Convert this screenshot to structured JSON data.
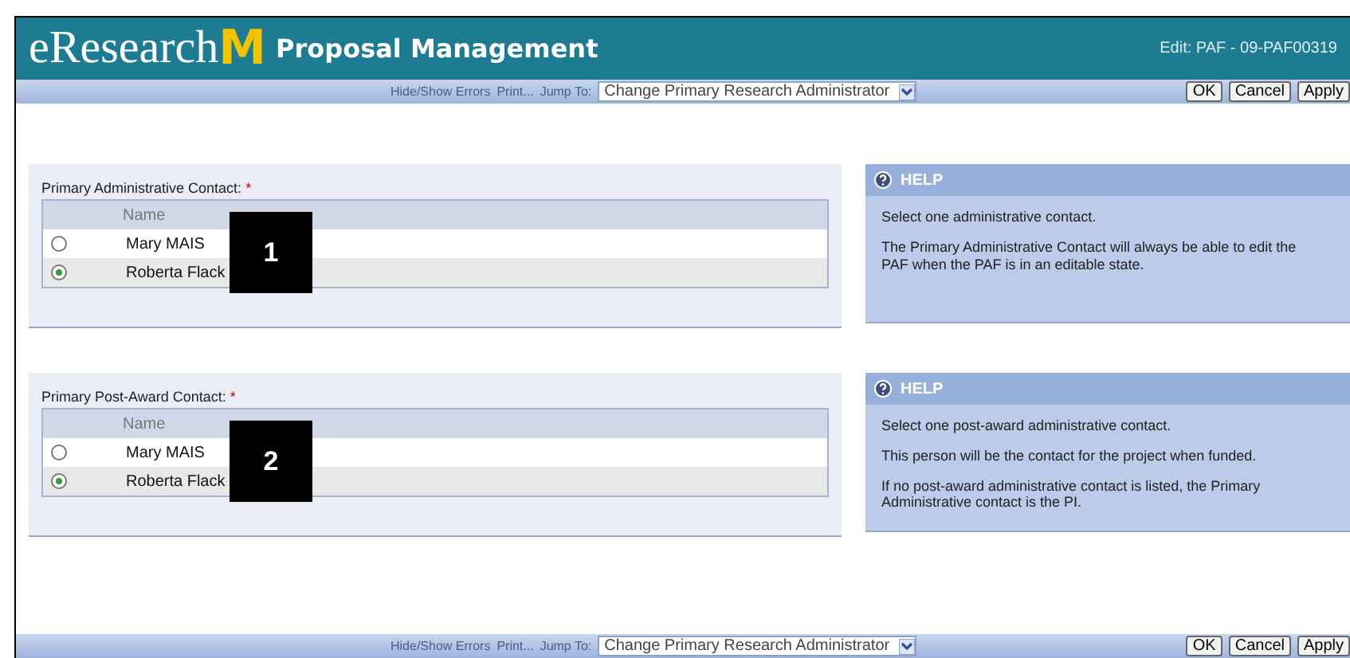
{
  "header": {
    "logo_text": "eResearch",
    "logo_letter": "M",
    "app_title": "Proposal Management",
    "context": "Edit: PAF - 09-PAF00319"
  },
  "toolbars": [
    {
      "links": [
        "Hide/Show Errors",
        "Print..."
      ],
      "jump_label": "Jump To:",
      "jump_value": "Change Primary Research Administrator",
      "buttons": [
        "OK",
        "Cancel",
        "Apply"
      ]
    },
    {
      "links": [
        "Hide/Show Errors",
        "Print..."
      ],
      "jump_label": "Jump To:",
      "jump_value": "Change Primary Research Administrator",
      "buttons": [
        "OK",
        "Cancel",
        "Apply"
      ]
    }
  ],
  "sections": [
    {
      "label": "Primary Administrative Contact:",
      "required_mark": "*",
      "column": "Name",
      "callout": "1",
      "rows": [
        {
          "name": "Mary MAIS",
          "selected": false
        },
        {
          "name": "Roberta Flack",
          "selected": true
        }
      ],
      "help_title": "HELP",
      "help": [
        "Select one administrative contact.",
        "The Primary Administrative Contact will always be able to edit the PAF when the PAF is in an editable state."
      ]
    },
    {
      "label": "Primary Post-Award Contact:",
      "required_mark": "*",
      "column": "Name",
      "callout": "2",
      "rows": [
        {
          "name": "Mary MAIS",
          "selected": false
        },
        {
          "name": "Roberta Flack",
          "selected": true
        }
      ],
      "help_title": "HELP",
      "help": [
        "Select one post-award administrative contact.",
        "This person will be the contact for the project when funded.",
        "If no post-award administrative contact is listed, the Primary Administrative contact is the PI."
      ]
    }
  ]
}
